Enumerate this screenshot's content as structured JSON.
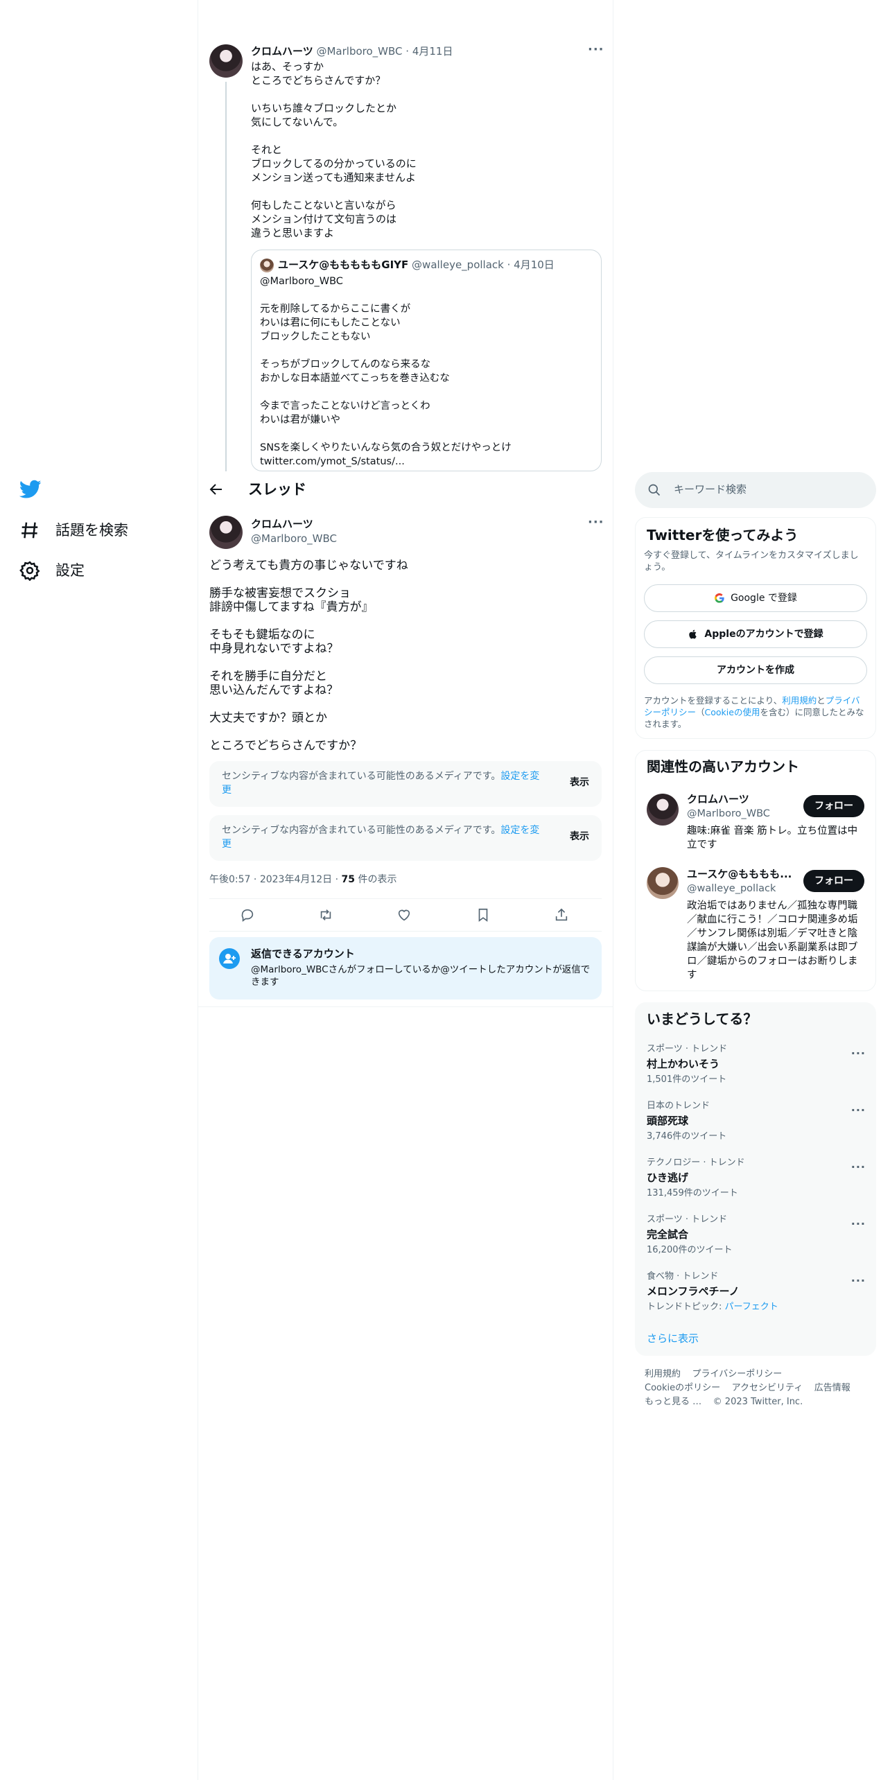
{
  "nav": {
    "items": [
      {
        "label": "話題を検索",
        "icon": "hashtag-icon"
      },
      {
        "label": "設定",
        "icon": "gear-icon"
      }
    ]
  },
  "parent_tweet": {
    "name": "クロムハーツ",
    "handle": "@Marlboro_WBC",
    "date": "4月11日",
    "text": "はあ、そっすか\nところでどちらさんですか？\n\nいちいち誰々ブロックしたとか\n気にしてないんで。\n\nそれと\nブロックしてるの分かっているのに\nメンション送っても通知来ませんよ\n\n何もしたことないと言いながら\nメンション付けて文句言うのは\n違うと思いますよ",
    "quote": {
      "name": "ユースケ@もももももGIYF",
      "handle": "@walleye_pollack",
      "date": "4月10日",
      "text": "@Marlboro_WBC\n\n元を削除してるからここに書くが\nわいは君に何にもしたことない\nブロックしたこともない\n\nそっちがブロックしてんのなら来るな\nおかしな日本語並べてこっちを巻き込むな\n\n今まで言ったことないけど言っとくわ\nわいは君が嫌いや\n\nSNSを楽しくやりたいんなら気の合う奴とだけやっとけ\ntwitter.com/ymot_S/status/..."
    }
  },
  "thread": {
    "title": "スレッド"
  },
  "main_tweet": {
    "name": "クロムハーツ",
    "handle": "@Marlboro_WBC",
    "text": "どう考えても貴方の事じゃないですね\n\n勝手な被害妄想でスクショ\n誹謗中傷してますね『貴方が』\n\nそもそも鍵垢なのに\n中身見れないですよね？\n\nそれを勝手に自分だと\n思い込んだんですよね？\n\n大丈夫ですか？頭とか\n\nところでどちらさんですか？",
    "sensitive": [
      {
        "msg": "センシティブな内容が含まれている可能性のあるメディアです。",
        "link": "設定を変更",
        "show": "表示"
      },
      {
        "msg": "センシティブな内容が含まれている可能性のあるメディアです。",
        "link": "設定を変更",
        "show": "表示"
      }
    ],
    "meta": {
      "time": "午後0:57",
      "date": "2023年4月12日",
      "views_count": "75",
      "views_suffix": "件の表示"
    },
    "reply_notice": {
      "title": "返信できるアカウント",
      "body": "@Marlboro_WBCさんがフォローしているか@ツイートしたアカウントが返信できます"
    }
  },
  "sidebar": {
    "search_placeholder": "キーワード検索",
    "signup": {
      "title": "Twitterを使ってみよう",
      "subtitle": "今すぐ登録して、タイムラインをカスタマイズしましょう。",
      "google": "Google で登録",
      "apple": "Appleのアカウントで登録",
      "create": "アカウントを作成",
      "legal_pre": "アカウントを登録することにより、",
      "legal_terms": "利用規約",
      "legal_and": "と",
      "legal_privacy": "プライバシーポリシー",
      "legal_paren_open": "（",
      "legal_cookie": "Cookieの使用",
      "legal_post": "を含む）に同意したとみなされます。"
    },
    "related": {
      "title": "関連性の高いアカウント",
      "accounts": [
        {
          "name": "クロムハーツ",
          "handle": "@Marlboro_WBC",
          "bio": "趣味:麻雀 音楽 筋トレ。立ち位置は中立です",
          "follow": "フォロー"
        },
        {
          "name": "ユースケ@もももも...",
          "handle": "@walleye_pollack",
          "bio": "政治垢ではありません／孤独な専門職／献血に行こう！／コロナ関連多め垢／サンフレ関係は別垢／デマ吐きと陰謀論が大嫌い／出会い系副業系は即ブロ／鍵垢からのフォローはお断りします",
          "follow": "フォロー"
        }
      ]
    },
    "trends": {
      "title": "いまどうしてる？",
      "items": [
        {
          "category": "スポーツ · トレンド",
          "name": "村上かわいそう",
          "count": "1,501件のツイート"
        },
        {
          "category": "日本のトレンド",
          "name": "頭部死球",
          "count": "3,746件のツイート"
        },
        {
          "category": "テクノロジー · トレンド",
          "name": "ひき逃げ",
          "count": "131,459件のツイート"
        },
        {
          "category": "スポーツ · トレンド",
          "name": "完全試合",
          "count": "16,200件のツイート"
        },
        {
          "category": "食べ物 · トレンド",
          "name": "メロンフラペチーノ",
          "count_prefix": "トレンドトピック: ",
          "count_link": "パーフェクト"
        }
      ],
      "show_more": "さらに表示"
    },
    "footer": {
      "line1": [
        "利用規約",
        "プライバシーポリシー"
      ],
      "line2": [
        "Cookieのポリシー",
        "アクセシビリティ",
        "広告情報"
      ],
      "more": "もっと見る …",
      "copyright": "© 2023 Twitter, Inc."
    }
  },
  "colors": {
    "accent": "#1d9bf0",
    "text": "#0f1419",
    "muted": "#536471",
    "border": "#eff3f4"
  }
}
